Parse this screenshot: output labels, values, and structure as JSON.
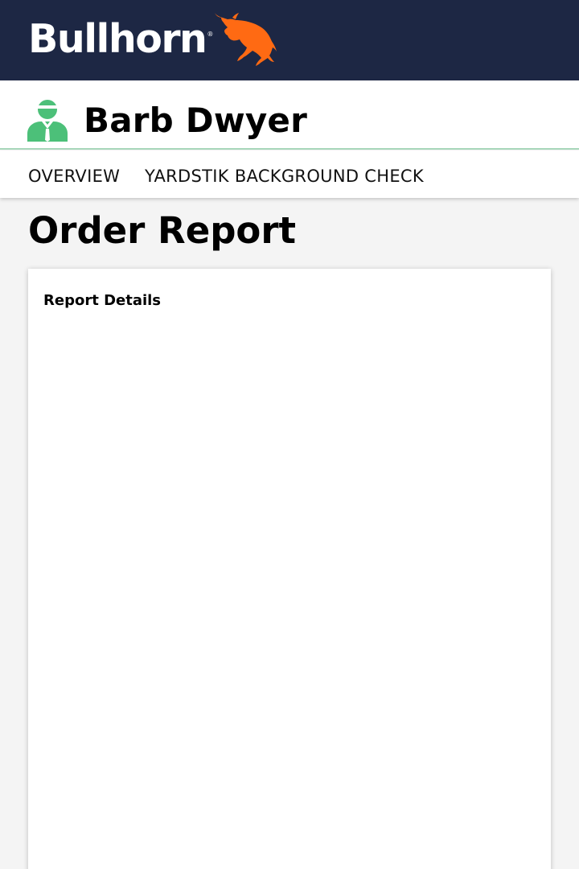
{
  "brand": {
    "name": "Bullhorn",
    "registered_mark": "®",
    "bar_color": "#1d2744",
    "bull_color": "#ff6a13"
  },
  "candidate": {
    "name": "Barb Dwyer",
    "icon": "person-icon",
    "icon_color": "#4cc079"
  },
  "tabs": [
    {
      "label": "OVERVIEW"
    },
    {
      "label": "YARDSTIK BACKGROUND CHECK"
    }
  ],
  "page": {
    "title": "Order Report"
  },
  "report_card": {
    "title": "Report Details"
  }
}
